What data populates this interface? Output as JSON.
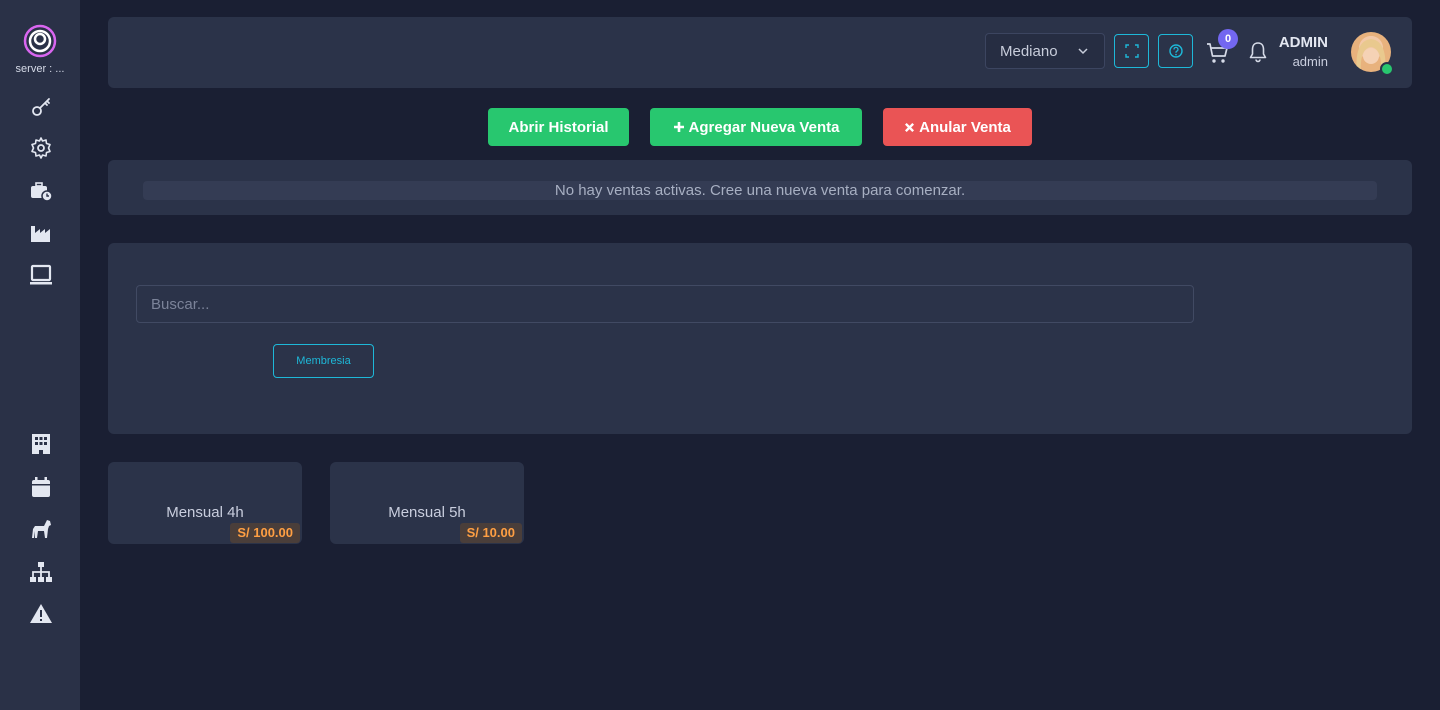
{
  "sidebar": {
    "server_label": "server : ...",
    "icons": [
      "key-icon",
      "gear-icon",
      "briefcase-clock-icon",
      "factory-icon",
      "laptop-icon",
      "building-icon",
      "calendar-icon",
      "horse-icon",
      "sitemap-icon",
      "warning-icon"
    ]
  },
  "header": {
    "size_select": "Mediano",
    "cart_count": "0",
    "user_name": "ADMIN",
    "user_role": "admin"
  },
  "actions": {
    "history": "Abrir Historial",
    "add_sale": "Agregar Nueva Venta",
    "void_sale": "Anular Venta"
  },
  "status": {
    "message": "No hay ventas activas. Cree una nueva venta para comenzar."
  },
  "search": {
    "placeholder": "Buscar...",
    "filter": "Membresia"
  },
  "products": [
    {
      "name": "Mensual 4h",
      "price": "S/ 100.00"
    },
    {
      "name": "Mensual 5h",
      "price": "S/ 10.00"
    }
  ],
  "colors": {
    "background": "#1a1f33",
    "panel": "#2b3349",
    "accent_cyan": "#1eb8d8",
    "success": "#28c76f",
    "danger": "#ea5455",
    "badge_purple": "#7367f0",
    "price_orange": "#ff9f43"
  }
}
